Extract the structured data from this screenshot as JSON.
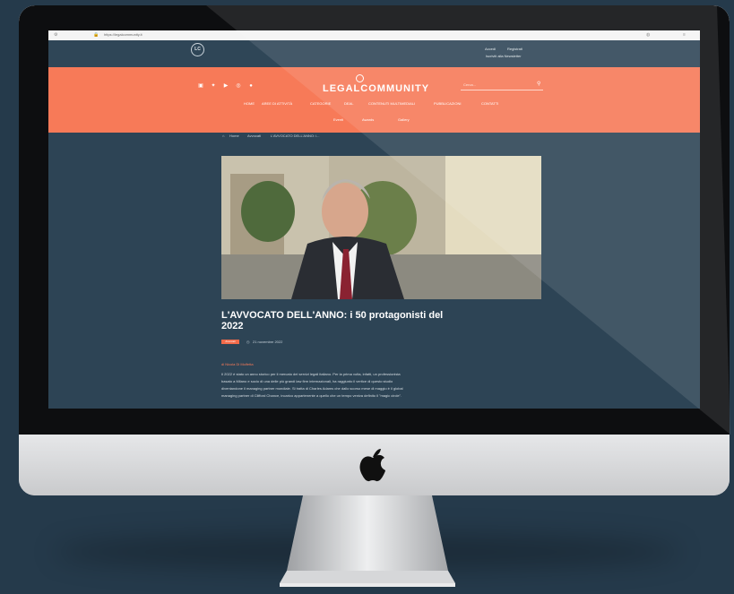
{
  "browser": {
    "url": "https://legalcommunity.it"
  },
  "header": {
    "logo_text": "LC",
    "links": [
      "Accedi",
      "Registrati",
      "Iscriviti alla Newsletter"
    ]
  },
  "brand": {
    "name": "LEGALCOMMUNITY"
  },
  "search": {
    "placeholder": "Cerca..."
  },
  "nav": {
    "primary": [
      "HOME",
      "AREE DI ATTIVITÀ",
      "CATEGORIE",
      "DEAL",
      "CONTENUTI MULTIMEDIALI",
      "PUBBLICAZIONI",
      "CONTATTI"
    ],
    "secondary": [
      "Eventi",
      "Awards",
      "Gallery"
    ]
  },
  "breadcrumb": [
    "Home",
    "Avvocati",
    "L'AVVOCATO DELL'ANNO: i..."
  ],
  "article": {
    "title": "L'AVVOCATO DELL'ANNO: i 50 protagonisti del 2022",
    "tag": "Avvocati",
    "date": "21 novembre 2022",
    "section": "di Nicola Di Molfetta",
    "paragraphs": [
      "Il 2022 è stato un anno storico per il mercato dei servizi legali italiano. Per la prima volta, infatti, un professionista",
      "basato a Milano e socio di una delle più grandi law firm internazionali, ha raggiunto il vertice di questo studio",
      "diventandone il managing partner mondiale. Si tratta di Charles Adams che dallo scorso mese di maggio è il global",
      "managing partner di Clifford Chance, incarico appartenente a quello che un tempo veniva definito il \"magic circle\"."
    ]
  },
  "colors": {
    "accent": "#f77a58",
    "background": "#2d4455",
    "page_bg": "#253a4b"
  }
}
